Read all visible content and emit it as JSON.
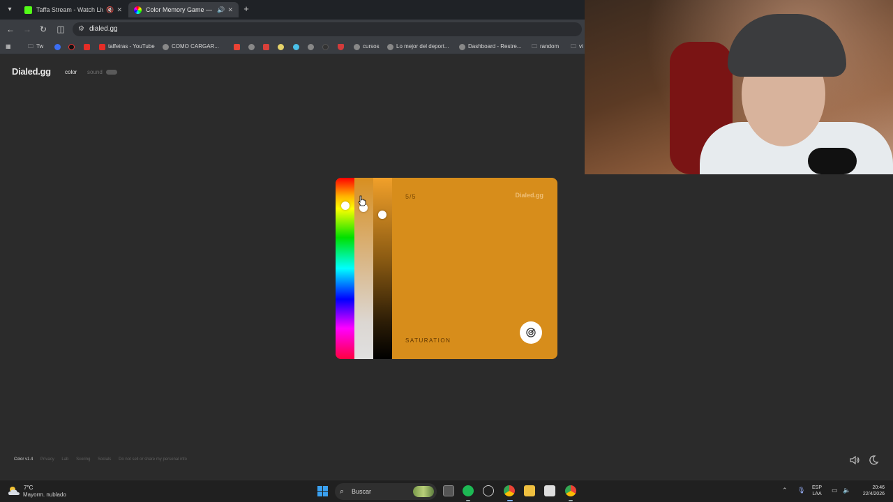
{
  "browser": {
    "tabs": [
      {
        "title": "Taffa Stream - Watch Live o",
        "active": false
      },
      {
        "title": "Color Memory Game — Ho",
        "active": true
      }
    ],
    "url": "dialed.gg",
    "bookmarks": [
      "Tw",
      "taffeiras - YouTube",
      "COMO CARGAR...",
      "cursos",
      "Lo mejor del deport...",
      "Dashboard - Restre...",
      "random",
      "vi"
    ]
  },
  "site": {
    "logo": "Dialed.gg",
    "nav_color": "color",
    "nav_sound": "sound"
  },
  "game": {
    "progress": "5/5",
    "brand": "Dialed.gg",
    "mode_label": "SATURATION",
    "current_color": "#d78d1b",
    "knobs": {
      "hue": 0.1,
      "saturation": 0.11,
      "brightness": 0.15
    }
  },
  "footer": {
    "items": [
      "Color v1.4",
      "Privacy",
      "Lab",
      "Scoring",
      "Socials",
      "Do not sell or share my personal info"
    ]
  },
  "taskbar": {
    "weather_temp": "7°C",
    "weather_desc": "Mayorm. nublado",
    "search_label": "Buscar",
    "lang_line1": "ESP",
    "lang_line2": "LAA",
    "time": "20:46",
    "date": "22/4/2026"
  }
}
